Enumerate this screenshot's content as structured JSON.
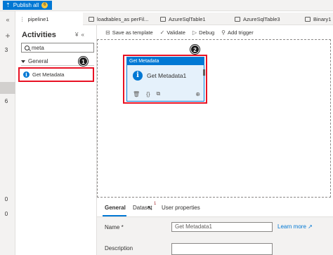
{
  "topbar": {
    "publish_label": "Publish all",
    "publish_count": "6"
  },
  "tabs": [
    {
      "label": "pipeline1"
    },
    {
      "label": "loadtables_as perFil..."
    },
    {
      "label": "AzureSqlTable1"
    },
    {
      "label": "AzureSqlTable3"
    },
    {
      "label": "Binary1"
    }
  ],
  "rail": {
    "collapse_glyph": "«",
    "plus_glyph": "+",
    "counts": [
      "3",
      "6",
      "0",
      "0"
    ]
  },
  "activities": {
    "title": "Activities",
    "search_value": "meta",
    "section": "General",
    "items": [
      {
        "label": "Get Metadata",
        "icon": "info-icon"
      }
    ]
  },
  "callouts": [
    "1",
    "2"
  ],
  "toolbar": {
    "save_template": "Save as template",
    "validate": "Validate",
    "debug": "Debug",
    "add_trigger": "Add trigger"
  },
  "card": {
    "header": "Get Metadata",
    "name": "Get Metadata1"
  },
  "properties": {
    "tabs": [
      "General",
      "Dataset",
      "User properties"
    ],
    "dataset_badge": "1",
    "name_label": "Name *",
    "name_value": "Get Metadata1",
    "learn_more": "Learn more",
    "description_label": "Description"
  },
  "colors": {
    "accent": "#0078d4",
    "highlight": "#e81123",
    "badge": "#ffc83d"
  }
}
